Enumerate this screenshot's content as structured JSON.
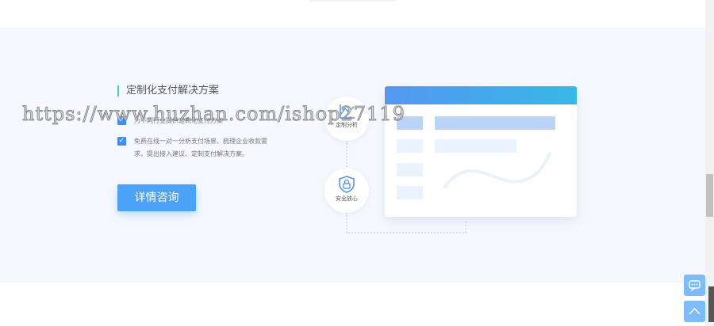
{
  "section": {
    "title": "定制化支付解决方案",
    "items": [
      {
        "text": "为不同行业提供定制化支付方案"
      },
      {
        "text": "免费在线一对一分析支付场景、梳理企业收款需求，提出接入建议、定制支付解决方案。"
      }
    ],
    "button_label": "详情咨询"
  },
  "illustration": {
    "nodes": [
      {
        "label": "定制分析",
        "icon": "chart-icon"
      },
      {
        "label": "安全放心",
        "icon": "lock-shield-icon"
      }
    ]
  },
  "watermark": "https://www.huzhan.com/ishop27119",
  "colors": {
    "accent": "#4aa3f8",
    "title_bar": "#3dd6b5",
    "background": "#f5f8fe"
  }
}
